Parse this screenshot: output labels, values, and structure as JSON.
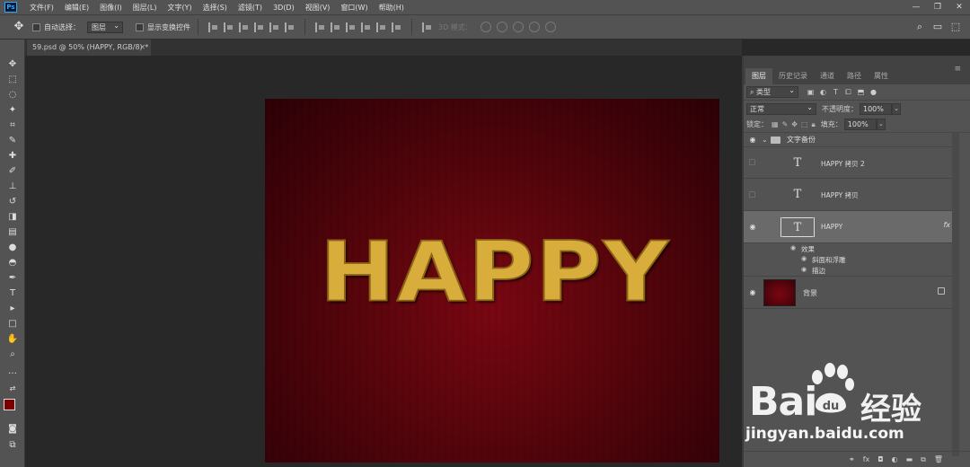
{
  "app": {
    "logo": "Ps"
  },
  "menubar": {
    "items": [
      "文件(F)",
      "编辑(E)",
      "图像(I)",
      "图层(L)",
      "文字(Y)",
      "选择(S)",
      "滤镜(T)",
      "3D(D)",
      "视图(V)",
      "窗口(W)",
      "帮助(H)"
    ]
  },
  "options": {
    "auto_select_label": "自动选择：",
    "auto_select_value": "图层",
    "show_transform_label": "显示变换控件",
    "mode_3d_label": "3D 模式："
  },
  "document": {
    "tab_title": "59.psd @ 50% (HAPPY, RGB/8) *",
    "canvas_text": "HAPPY"
  },
  "layers_panel": {
    "tabs": [
      "图层",
      "历史记录",
      "通道",
      "路径",
      "属性"
    ],
    "active_tab": "图层",
    "filter_label": "类型",
    "blend_mode": "正常",
    "opacity_label": "不透明度：",
    "opacity_value": "100%",
    "lock_label": "锁定：",
    "fill_label": "填充：",
    "fill_value": "100%",
    "group_name": "文字备份",
    "layers": [
      {
        "name": "HAPPY 拷贝 2",
        "visible": false
      },
      {
        "name": "HAPPY 拷贝",
        "visible": false
      },
      {
        "name": "HAPPY",
        "visible": true,
        "selected": true,
        "fx": "fx"
      }
    ],
    "effects_label": "效果",
    "effects": [
      "斜面和浮雕",
      "描边"
    ],
    "background_name": "背景"
  },
  "watermark": {
    "brand": "Bai",
    "brand2": "du",
    "cn": "经验",
    "url": "jingyan.baidu.com"
  },
  "colors": {
    "canvas_red": "#5a050c",
    "text_gold": "#d8ad3c",
    "ui_dark": "#535353"
  }
}
